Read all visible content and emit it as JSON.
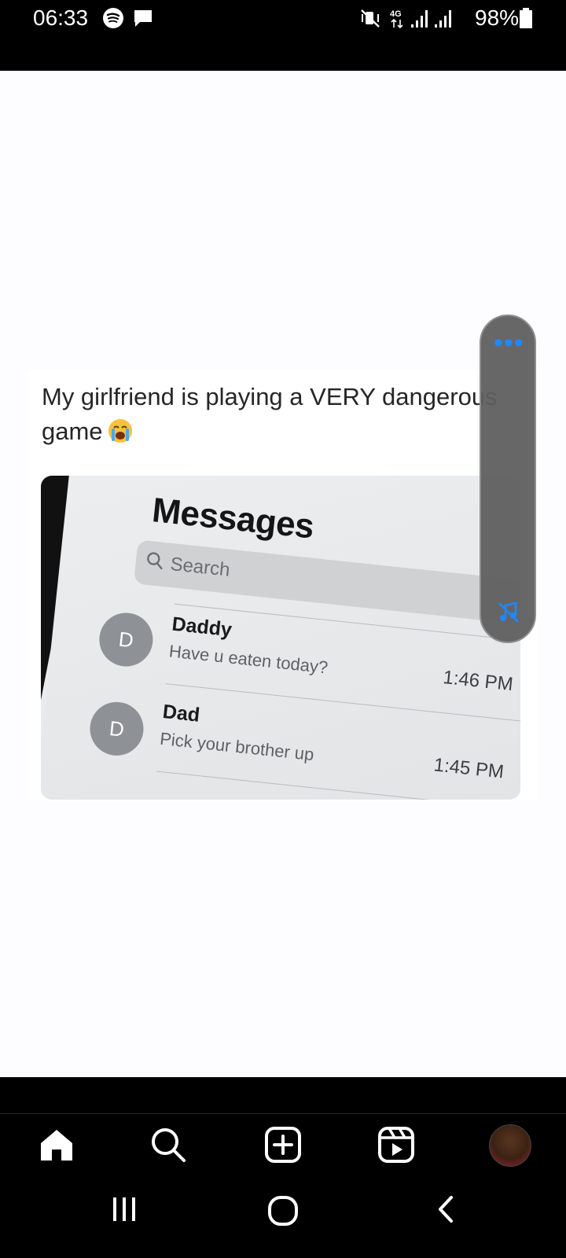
{
  "status_bar": {
    "time": "06:33",
    "battery_percent": "98%",
    "network": "4G",
    "icons": [
      "spotify-icon",
      "chat-bubble-icon",
      "mute-vibrate-icon",
      "signal-icon",
      "battery-icon"
    ]
  },
  "post": {
    "caption": "My girlfriend is playing a VERY dangerous game",
    "caption_emoji": "loudly-crying-face-emoji",
    "image": {
      "title": "Messages",
      "search_placeholder": "Search",
      "conversations": [
        {
          "avatar_letter": "D",
          "name": "Daddy",
          "preview": "Have u eaten today?",
          "time": "1:46 PM"
        },
        {
          "avatar_letter": "D",
          "name": "Dad",
          "preview": "Pick your brother up",
          "time": "1:45 PM"
        }
      ]
    }
  },
  "floating_panel": {
    "menu_icon": "more-dots-icon",
    "action_icon": "music-off-icon",
    "accent_color": "#1e88ff"
  },
  "bottom_nav": {
    "items": [
      "home-icon",
      "search-icon",
      "create-icon",
      "reels-icon",
      "profile-avatar"
    ]
  },
  "system_nav": {
    "items": [
      "recents-icon",
      "home-circle-icon",
      "back-icon"
    ]
  }
}
